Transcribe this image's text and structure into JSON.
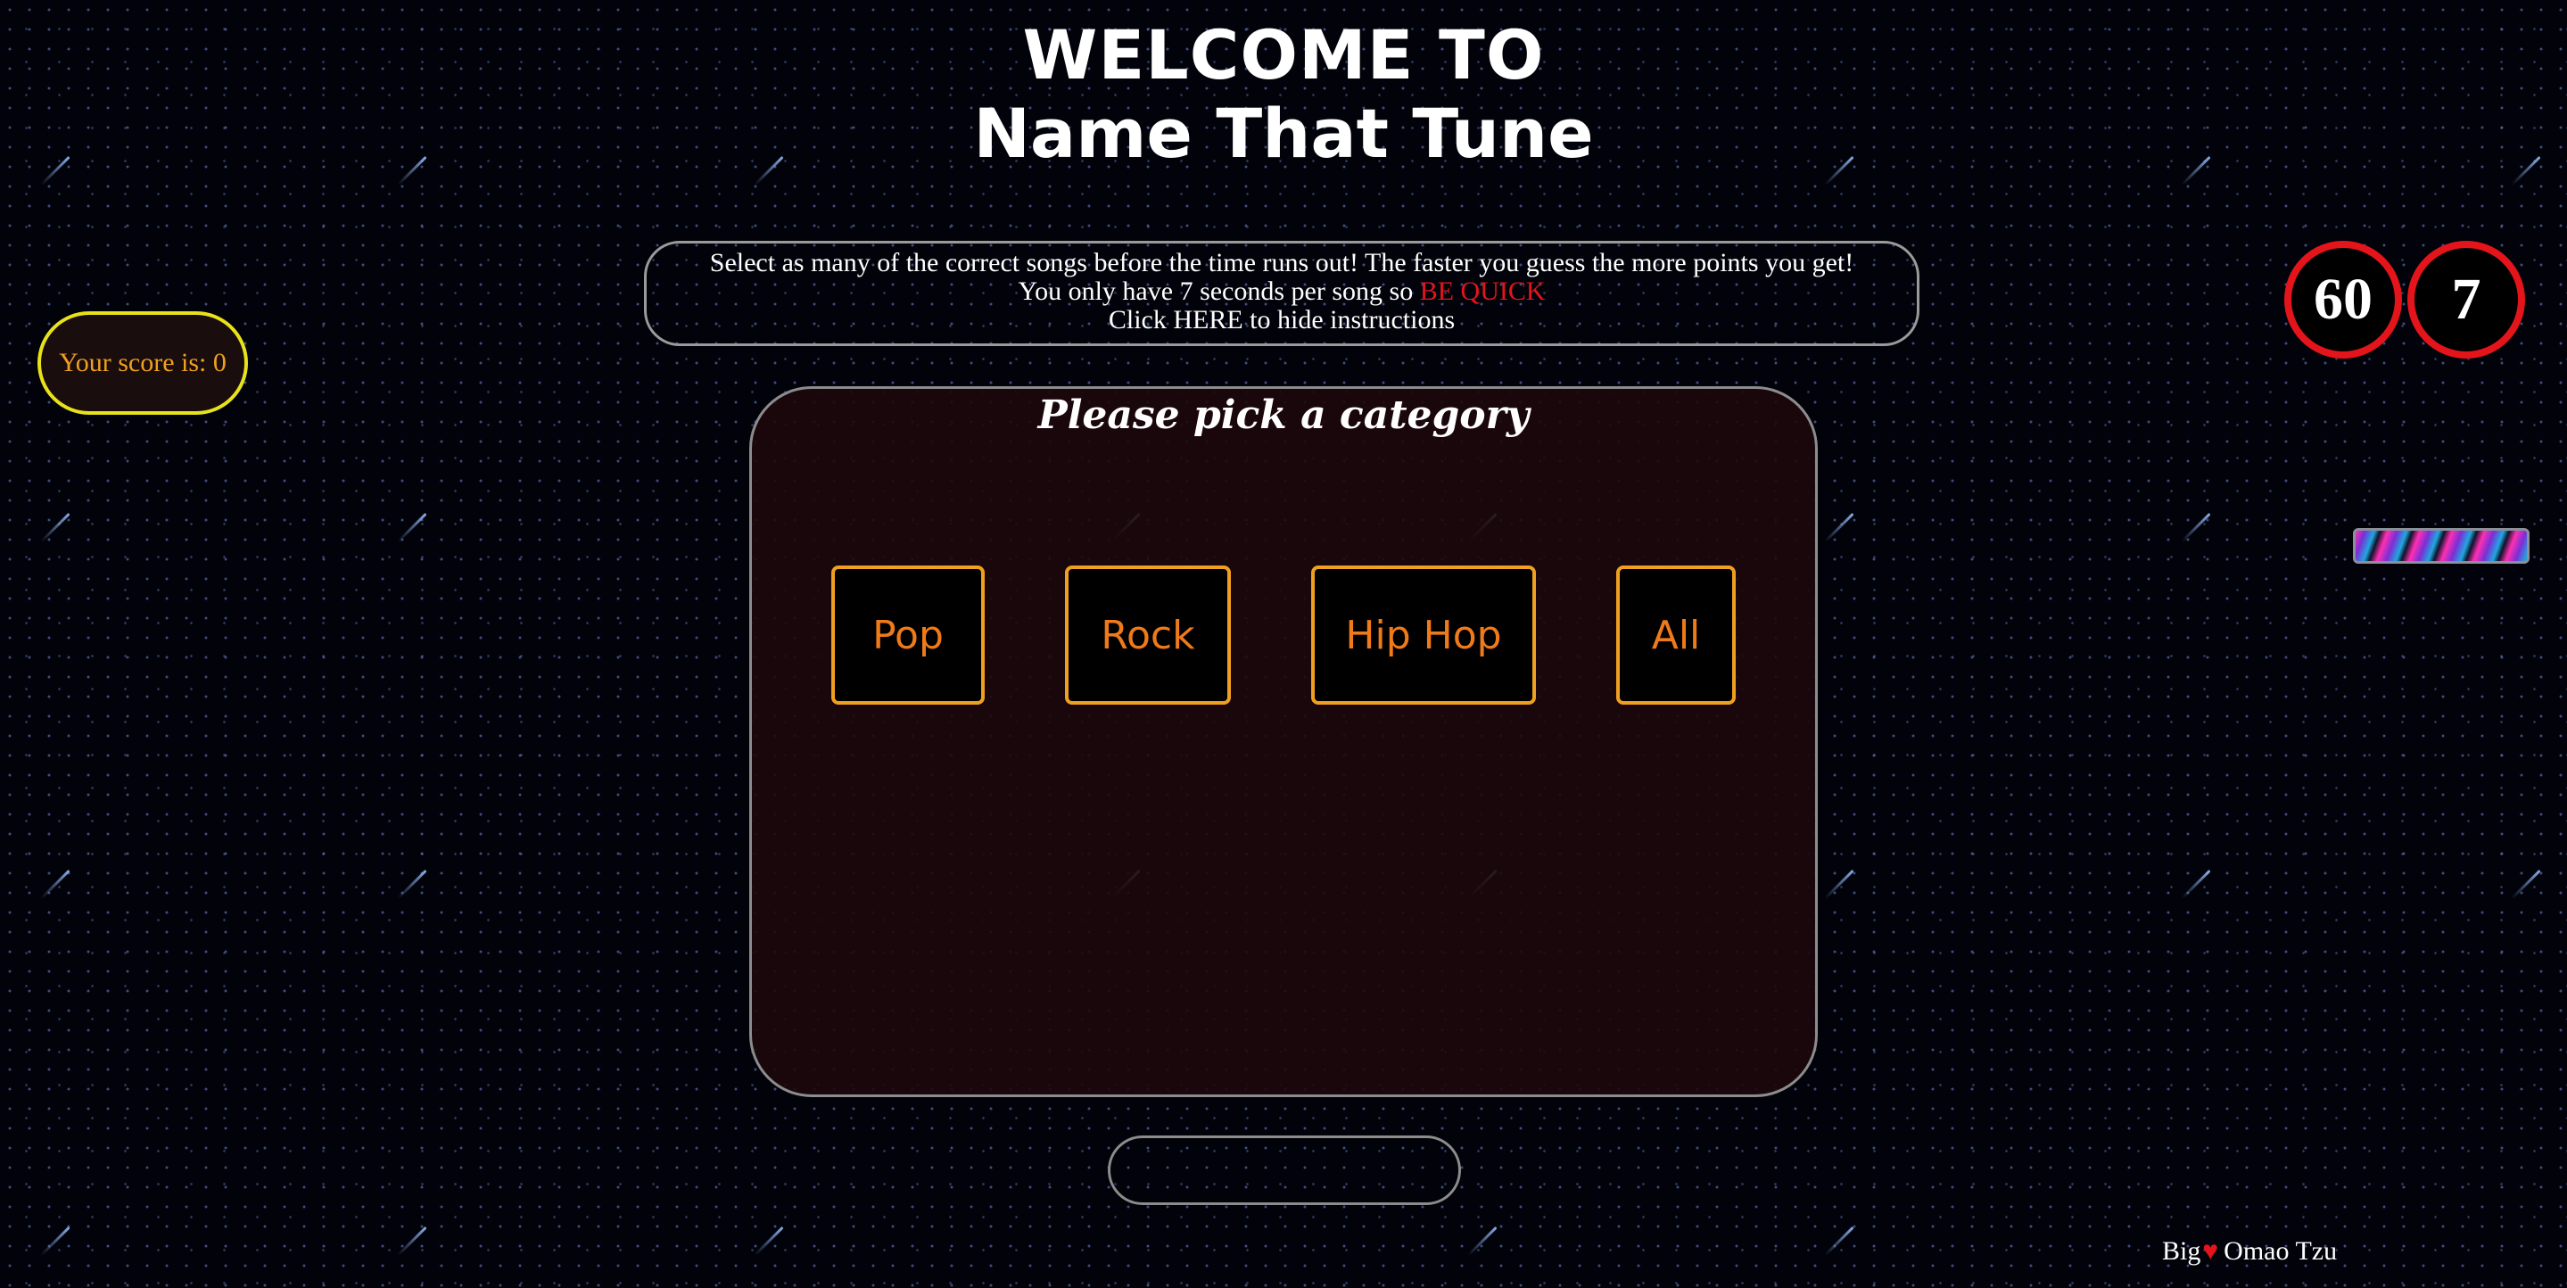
{
  "header": {
    "title_line1": "WELCOME TO",
    "title_line2": "Name That Tune"
  },
  "instructions": {
    "line1": "Select as many of the correct songs before the time runs out! The faster you guess the more points you get!",
    "line2_prefix": "You only have 7 seconds per song so ",
    "line2_emphasis": "BE QUICK",
    "line3": "Click HERE to hide instructions"
  },
  "score": {
    "text": "Your score is: 0"
  },
  "timers": {
    "total_seconds": "60",
    "song_seconds": "7"
  },
  "category_panel": {
    "title": "Please pick a category",
    "categories": [
      "Pop",
      "Rock",
      "Hip Hop",
      "All"
    ]
  },
  "footer": {
    "credit_before": "Big",
    "credit_icon": "heart-icon",
    "credit_after": "Omao Tzu"
  },
  "colors": {
    "accent_red": "#e4141b",
    "score_border": "#e8e21a",
    "category_border": "#f0a020",
    "category_text": "#ef7a1a"
  }
}
